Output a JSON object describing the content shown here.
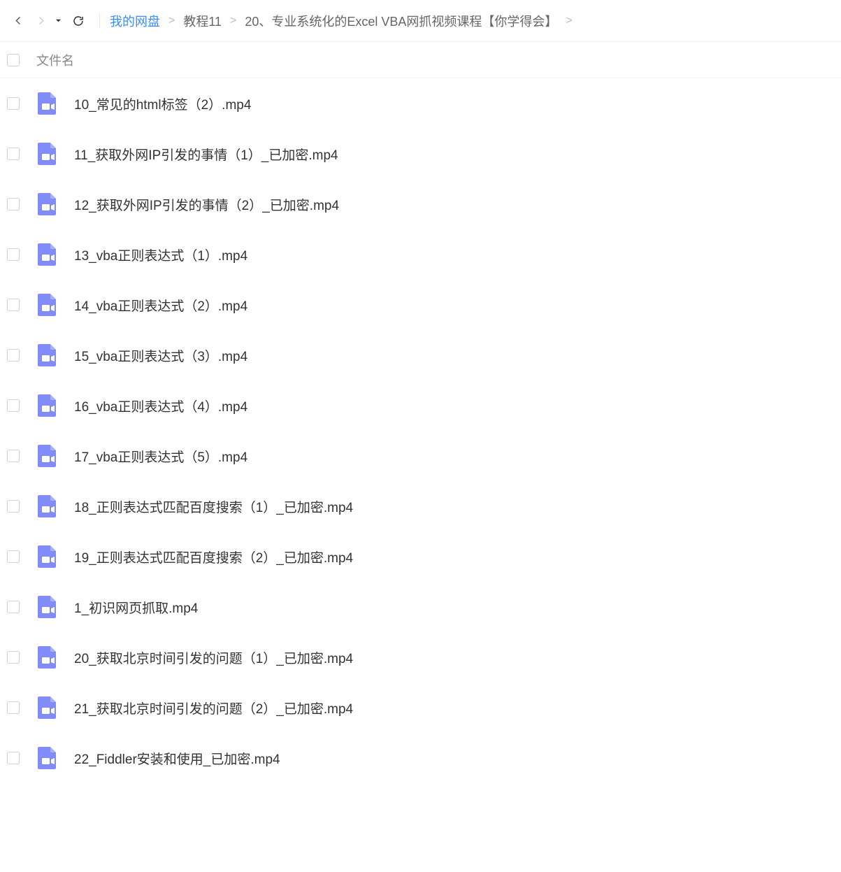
{
  "breadcrumb": {
    "root": "我的网盘",
    "items": [
      "教程11",
      "20、专业系统化的Excel VBA网抓视频课程【你学得会】"
    ],
    "sep": ">"
  },
  "header": {
    "filename_label": "文件名"
  },
  "files": [
    {
      "name": "10_常见的html标签（2）.mp4"
    },
    {
      "name": "11_获取外网IP引发的事情（1）_已加密.mp4"
    },
    {
      "name": "12_获取外网IP引发的事情（2）_已加密.mp4"
    },
    {
      "name": "13_vba正则表达式（1）.mp4"
    },
    {
      "name": "14_vba正则表达式（2）.mp4"
    },
    {
      "name": "15_vba正则表达式（3）.mp4"
    },
    {
      "name": "16_vba正则表达式（4）.mp4"
    },
    {
      "name": "17_vba正则表达式（5）.mp4"
    },
    {
      "name": "18_正则表达式匹配百度搜索（1）_已加密.mp4"
    },
    {
      "name": "19_正则表达式匹配百度搜索（2）_已加密.mp4"
    },
    {
      "name": "1_初识网页抓取.mp4"
    },
    {
      "name": "20_获取北京时间引发的问题（1）_已加密.mp4"
    },
    {
      "name": "21_获取北京时间引发的问题（2）_已加密.mp4"
    },
    {
      "name": "22_Fiddler安装和使用_已加密.mp4"
    }
  ]
}
